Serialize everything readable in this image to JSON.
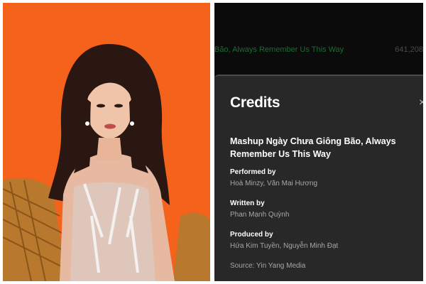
{
  "track_row": {
    "title": "Bão, Always Remember Us This Way",
    "plays": "641,208"
  },
  "credits_modal": {
    "title": "Credits",
    "close_glyph": "×",
    "song_name": "Mashup Ngày Chưa Giông Bão, Always Remember Us This Way",
    "sections": [
      {
        "role": "Performed by",
        "people": "Hoà Minzy, Văn Mai Hương"
      },
      {
        "role": "Written by",
        "people": "Phan Mạnh Quỳnh"
      },
      {
        "role": "Produced by",
        "people": "Hứa Kim Tuyền, Nguyễn Minh Đạt"
      }
    ],
    "source": "Source: Yin Yang Media"
  },
  "colors": {
    "photo_background": "#f4621c",
    "modal_background": "#282828",
    "track_title_green": "#1b6b33",
    "secondary_text": "#a7a7a7"
  },
  "icons": {
    "close": "close-icon"
  }
}
